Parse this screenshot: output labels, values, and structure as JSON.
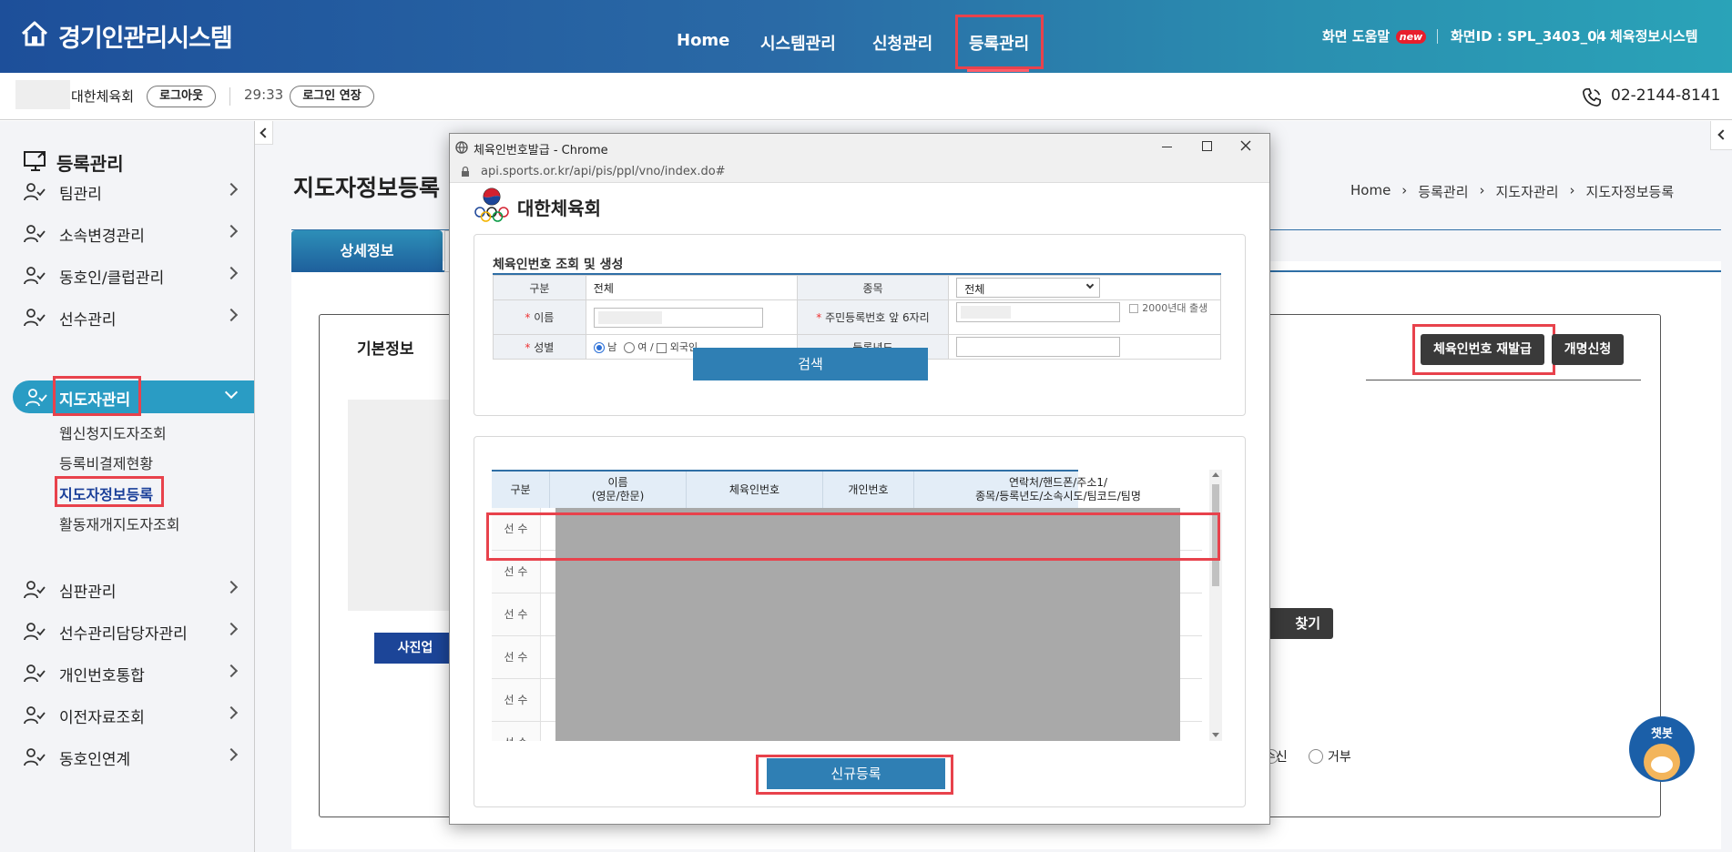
{
  "header": {
    "title": "경기인관리시스템",
    "nav": [
      "Home",
      "시스템관리",
      "신청관리",
      "등록관리"
    ],
    "help_label": "화면 도움말",
    "new_badge": "new",
    "screen_id": "화면ID : SPL_3403_04",
    "system_link": "체육정보시스템"
  },
  "subbar": {
    "org": "대한체육회",
    "logout": "로그아웃",
    "timer": "29:33",
    "extend": "로그인 연장",
    "phone": "02-2144-8141"
  },
  "sidebar": {
    "title": "등록관리",
    "items": [
      "팀관리",
      "소속변경관리",
      "동호인/클럽관리",
      "선수관리",
      "지도자관리"
    ],
    "subitems": [
      "웹신청지도자조회",
      "등록비결제현황",
      "지도자정보등록",
      "활동재개지도자조회"
    ],
    "items2": [
      "심판관리",
      "선수관리담당자관리",
      "개인번호통합",
      "이전자료조회",
      "동호인연계"
    ]
  },
  "main": {
    "page_title": "지도자정보등록",
    "breadcrumb": [
      "Home",
      "등록관리",
      "지도자관리",
      "지도자정보등록"
    ],
    "tab": "상세정보",
    "section": "기본정보",
    "reissue_btn": "체육인번호 재발급",
    "rename_btn": "개명신청",
    "photo_btn": "사진업",
    "find_btn": "찾기",
    "receive": "수신",
    "reject": "거부",
    "chatbot": "챗봇"
  },
  "popup": {
    "window_title": "체육인번호발급 - Chrome",
    "url": "api.sports.or.kr/api/pis/ppl/vno/index.do#",
    "brand": "대한체육회",
    "section_title": "체육인번호 조회 및 생성",
    "form": {
      "gubun_label": "구분",
      "gubun_value": "전체",
      "jongmok_label": "종목",
      "jongmok_value": "전체",
      "name_label": "이름",
      "rrn_label": "주민등록번호 앞 6자리",
      "y2000_label": "2000년대 출생",
      "gender_label": "성별",
      "male": "남",
      "female": "여 /",
      "foreigner": "외국인",
      "reg_year_label": "등록년도"
    },
    "search_btn": "검색",
    "result_headers": [
      "구분",
      "이름\n(영문/한문)",
      "체육인번호",
      "개인번호",
      "연락처/핸드폰/주소1/\n종목/등록년도/소속시도/팀코드/팀명"
    ],
    "result_rows": [
      "선 수",
      "선 수",
      "선 수",
      "선 수",
      "선 수",
      "선 수"
    ],
    "new_reg_btn": "신규등록"
  },
  "colors": {
    "accent": "#2f7fb4",
    "highlight": "#e8424c",
    "header_start": "#1d4f9a",
    "header_end": "#2aa3b8"
  }
}
